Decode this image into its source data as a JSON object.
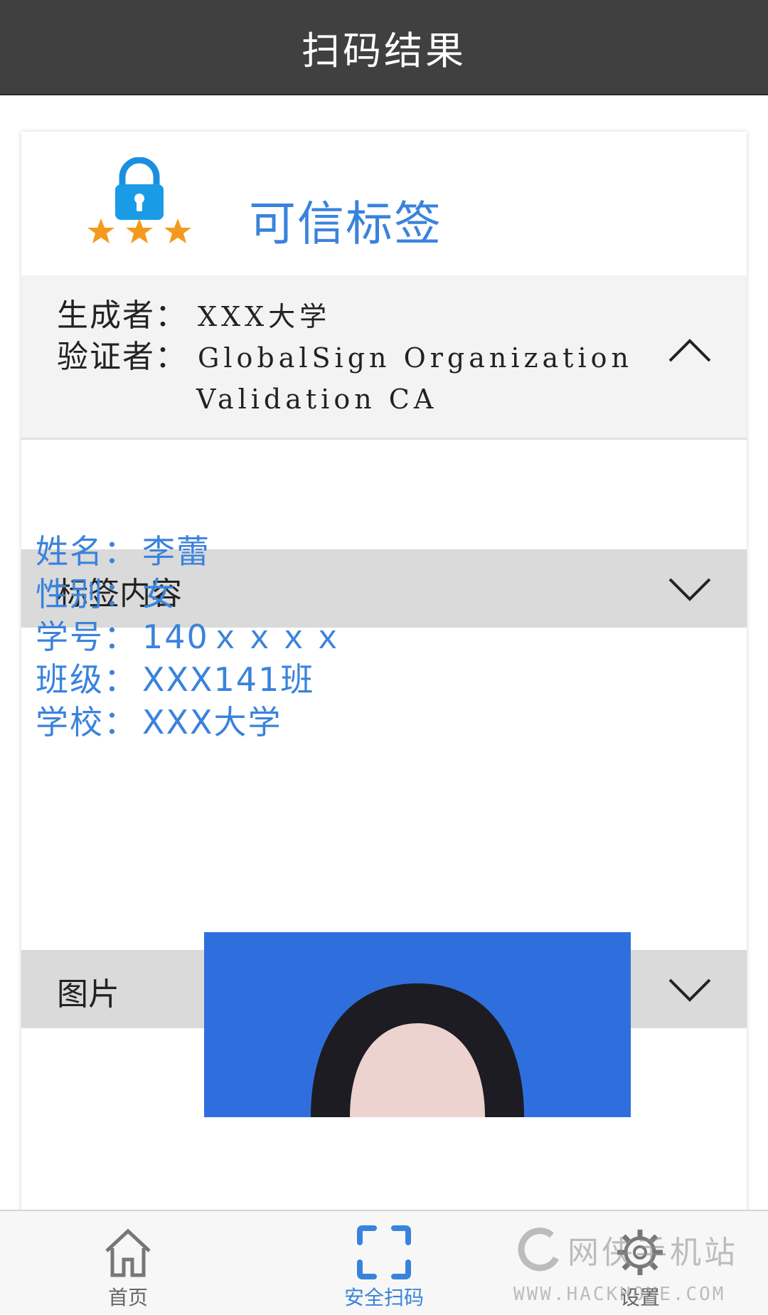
{
  "header": {
    "title": "扫码结果"
  },
  "badge": {
    "title": "可信标签",
    "icon": "lock-with-three-stars-icon",
    "accent": "#3a83dc",
    "star_color": "#f39a1e"
  },
  "signer": {
    "creator_label": "生成者：",
    "creator_value": "XXX大学",
    "verifier_label": "验证者：",
    "verifier_value_line1": "GlobalSign Organization",
    "verifier_value_line2": "Validation CA"
  },
  "sections": {
    "content": {
      "title": "标签内容"
    },
    "picture": {
      "title": "图片"
    }
  },
  "info": [
    {
      "key": "姓名：",
      "value": "李蕾"
    },
    {
      "key": "性别：",
      "value": "女"
    },
    {
      "key": "学号：",
      "value": "140ｘｘｘｘ"
    },
    {
      "key": "班级：",
      "value": "XXX141班"
    },
    {
      "key": "学校：",
      "value": "XXX大学"
    }
  ],
  "tabbar": {
    "home": {
      "label": "首页",
      "icon": "home-icon"
    },
    "scan": {
      "label": "安全扫码",
      "icon": "scan-frame-icon"
    },
    "settings": {
      "label": "设置",
      "icon": "gear-icon"
    }
  },
  "watermark": {
    "line1": "网侠手机站",
    "line2": "WWW.HACKHOME.COM"
  }
}
